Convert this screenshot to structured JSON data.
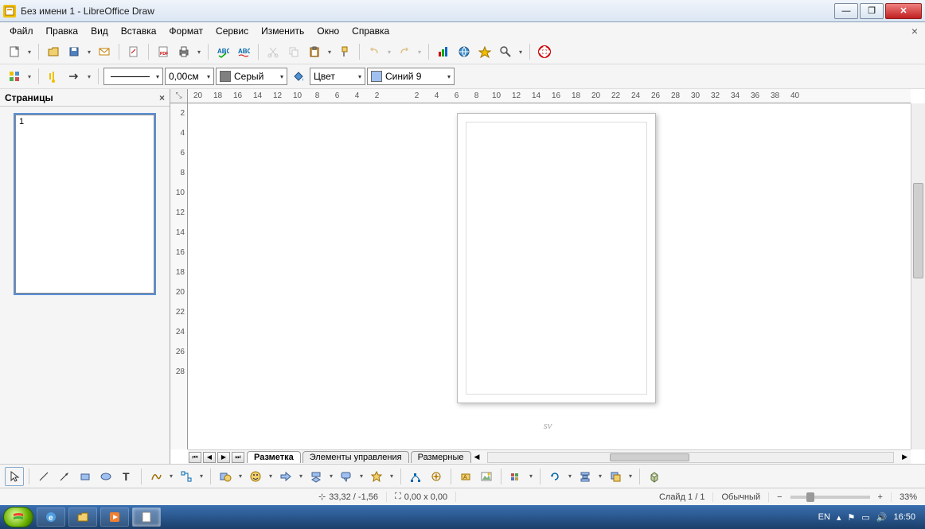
{
  "title": "Без имени 1 - LibreOffice Draw",
  "menu": [
    "Файл",
    "Правка",
    "Вид",
    "Вставка",
    "Формат",
    "Сервис",
    "Изменить",
    "Окно",
    "Справка"
  ],
  "linewidth_value": "0,00см",
  "areacolor_name": "Серый",
  "fillmode": "Цвет",
  "fillcolor_name": "Синий 9",
  "ruler_h": [
    "20",
    "18",
    "16",
    "14",
    "12",
    "10",
    "8",
    "6",
    "4",
    "2",
    "",
    "2",
    "4",
    "6",
    "8",
    "10",
    "12",
    "14",
    "16",
    "18",
    "20",
    "22",
    "24",
    "26",
    "28",
    "30",
    "32",
    "34",
    "36",
    "38",
    "40"
  ],
  "ruler_v": [
    "2",
    "4",
    "6",
    "8",
    "10",
    "12",
    "14",
    "16",
    "18",
    "20",
    "22",
    "24",
    "26",
    "28"
  ],
  "panel_title": "Страницы",
  "thumb_number": "1",
  "layer_tabs": [
    "Разметка",
    "Элементы управления",
    "Размерные"
  ],
  "status": {
    "coords": "33,32 / -1,56",
    "size": "0,00 x 0,00",
    "slide": "Слайд 1 / 1",
    "style": "Обычный",
    "zoom": "33%"
  },
  "watermark": "sv",
  "taskbar": {
    "lang": "EN",
    "clock": "16:50"
  }
}
